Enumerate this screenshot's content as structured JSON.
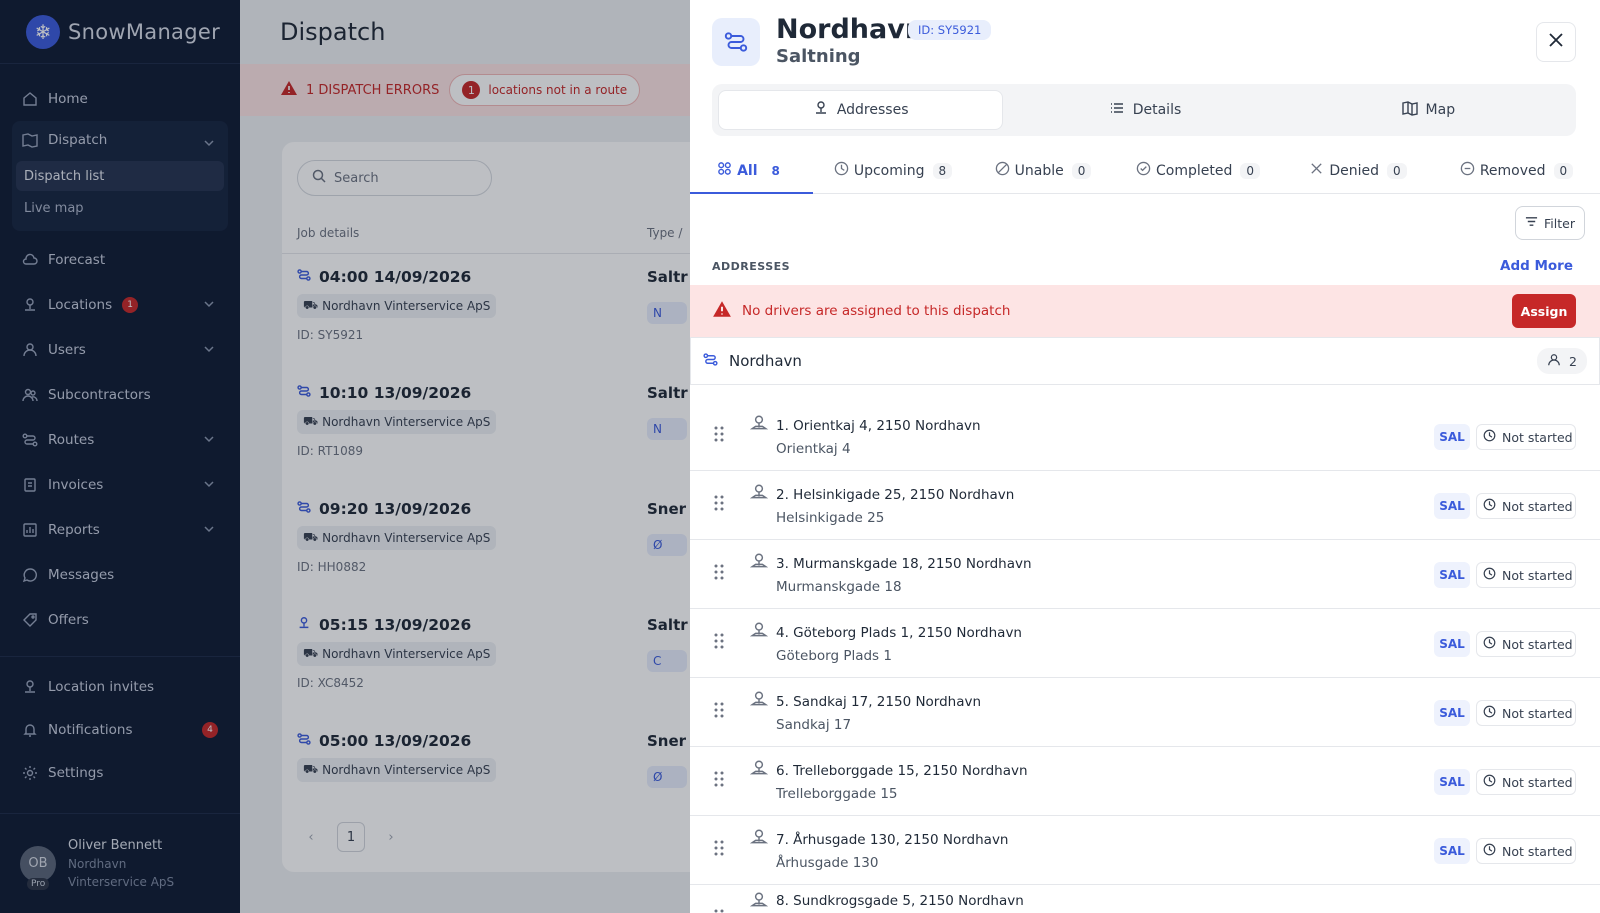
{
  "app": {
    "name": "SnowManager"
  },
  "sidebar": {
    "items_top": [
      {
        "label": "Home",
        "icon": "home-icon"
      }
    ],
    "dispatch": {
      "label": "Dispatch",
      "sub": [
        {
          "label": "Dispatch list",
          "active": true
        },
        {
          "label": "Live map"
        }
      ]
    },
    "items_mid": [
      {
        "label": "Forecast",
        "icon": "cloud-icon"
      },
      {
        "label": "Locations",
        "icon": "location-icon",
        "badge": "1",
        "chevron": true
      },
      {
        "label": "Users",
        "icon": "user-icon",
        "chevron": true
      },
      {
        "label": "Subcontractors",
        "icon": "users-icon"
      },
      {
        "label": "Routes",
        "icon": "route-icon",
        "chevron": true
      },
      {
        "label": "Invoices",
        "icon": "invoice-icon",
        "chevron": true
      },
      {
        "label": "Reports",
        "icon": "chart-icon",
        "chevron": true
      },
      {
        "label": "Messages",
        "icon": "message-icon"
      },
      {
        "label": "Offers",
        "icon": "offer-icon"
      }
    ],
    "items_bottom": [
      {
        "label": "Location invites",
        "icon": "location-invite-icon"
      },
      {
        "label": "Notifications",
        "icon": "bell-icon",
        "badge": "4"
      },
      {
        "label": "Settings",
        "icon": "gear-icon"
      }
    ],
    "user": {
      "initials": "OB",
      "plan": "Pro",
      "name": "Oliver Bennett",
      "company": "Nordhavn Vinterservice ApS"
    }
  },
  "main": {
    "title": "Dispatch",
    "error_text": "1 DISPATCH ERRORS",
    "error_chip": {
      "count": "1",
      "text": "locations not in a route"
    },
    "search_placeholder": "Search",
    "columns": {
      "job": "Job details",
      "type": "Type /"
    },
    "jobs": [
      {
        "time": "04:00 14/09/2026",
        "company": "Nordhavn Vinterservice ApS",
        "id": "ID: SY5921",
        "type": "Saltr",
        "chip": "N",
        "icon": "route-icon"
      },
      {
        "time": "10:10 13/09/2026",
        "company": "Nordhavn Vinterservice ApS",
        "id": "ID: RT1089",
        "type": "Saltr",
        "chip": "N",
        "icon": "route-icon"
      },
      {
        "time": "09:20 13/09/2026",
        "company": "Nordhavn Vinterservice ApS",
        "id": "ID: HH0882",
        "type": "Sner",
        "chip": "Ø",
        "icon": "route-icon"
      },
      {
        "time": "05:15 13/09/2026",
        "company": "Nordhavn Vinterservice ApS",
        "id": "ID: XC8452",
        "type": "Saltr",
        "chip": "C",
        "icon": "location-icon"
      },
      {
        "time": "05:00 13/09/2026",
        "company": "Nordhavn Vinterservice ApS",
        "id": "",
        "type": "Sner",
        "chip": "Ø",
        "icon": "route-icon"
      }
    ],
    "page": "1"
  },
  "panel": {
    "title": "Nordhavn",
    "id_badge": "ID: SY5921",
    "subtitle": "Saltning",
    "segments": [
      {
        "label": "Addresses",
        "icon": "location-icon",
        "active": true
      },
      {
        "label": "Details",
        "icon": "list-icon"
      },
      {
        "label": "Map",
        "icon": "map-icon"
      }
    ],
    "tabs": [
      {
        "label": "All",
        "count": "8",
        "icon": "grid-icon",
        "active": true
      },
      {
        "label": "Upcoming",
        "count": "8",
        "icon": "clock-icon"
      },
      {
        "label": "Unable",
        "count": "0",
        "icon": "ban-icon"
      },
      {
        "label": "Completed",
        "count": "0",
        "icon": "check-circle-icon"
      },
      {
        "label": "Denied",
        "count": "0",
        "icon": "x-icon"
      },
      {
        "label": "Removed",
        "count": "0",
        "icon": "minus-circle-icon"
      }
    ],
    "filter_label": "Filter",
    "section_header": "ADDRESSES",
    "add_more": "Add More",
    "alert": {
      "text": "No drivers are assigned to this dispatch",
      "button": "Assign"
    },
    "route": {
      "name": "Nordhavn",
      "people": "2"
    },
    "addresses": [
      {
        "title": "1. Orientkaj 4, 2150 Nordhavn",
        "sub": "Orientkaj 4",
        "tag": "SAL",
        "status": "Not started"
      },
      {
        "title": "2. Helsinkigade 25, 2150 Nordhavn",
        "sub": "Helsinkigade 25",
        "tag": "SAL",
        "status": "Not started"
      },
      {
        "title": "3. Murmanskgade 18, 2150 Nordhavn",
        "sub": "Murmanskgade 18",
        "tag": "SAL",
        "status": "Not started"
      },
      {
        "title": "4. Göteborg Plads 1, 2150 Nordhavn",
        "sub": "Göteborg Plads 1",
        "tag": "SAL",
        "status": "Not started"
      },
      {
        "title": "5. Sandkaj 17, 2150 Nordhavn",
        "sub": "Sandkaj 17",
        "tag": "SAL",
        "status": "Not started"
      },
      {
        "title": "6. Trelleborggade 15, 2150 Nordhavn",
        "sub": "Trelleborggade 15",
        "tag": "SAL",
        "status": "Not started"
      },
      {
        "title": "7. Århusgade 130, 2150 Nordhavn",
        "sub": "Århusgade 130",
        "tag": "SAL",
        "status": "Not started"
      },
      {
        "title": "8. Sundkrogsgade 5, 2150 Nordhavn",
        "sub": "",
        "tag": "",
        "status": ""
      }
    ]
  }
}
